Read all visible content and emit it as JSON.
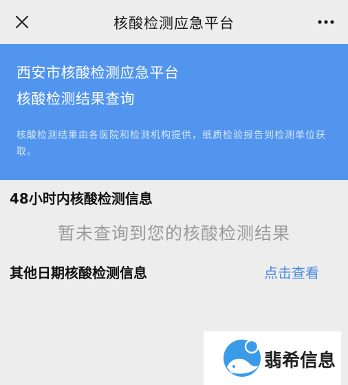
{
  "header": {
    "title": "核酸检测应急平台",
    "close_icon": "close-icon",
    "more_icon": "more-icon"
  },
  "banner": {
    "title": "西安市核酸检测应急平台",
    "subtitle": "核酸检测结果查询",
    "notice": "核酸检测结果由各医院和检测机构提供，纸质检验报告到检测单位获取。",
    "background_color": "#5195ee"
  },
  "results": {
    "section_title": "48小时内核酸检测信息",
    "empty_message": "暂未查询到您的核酸检测结果"
  },
  "other": {
    "label": "其他日期核酸检测信息",
    "link_text": "点击查看",
    "link_color": "#4a8be0"
  },
  "watermark": {
    "text": "翡希信息",
    "logo_icon": "mouse-logo-icon"
  }
}
